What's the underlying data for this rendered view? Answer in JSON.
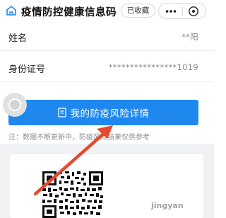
{
  "header": {
    "title": "疫情防控健康信息码",
    "favorite_label": "已收藏",
    "icons": [
      "home-icon",
      "more-icon",
      "close-icon"
    ]
  },
  "fields": [
    {
      "label": "姓名",
      "value": "**阳"
    },
    {
      "label": "身份证号",
      "value": "****************1019"
    }
  ],
  "cta": {
    "label": "我的防疫风险详情",
    "icon": "document-icon"
  },
  "note": "注：数据不断更新中，防疫风险结果仅供参考",
  "watermark": "jingyan",
  "colors": {
    "accent": "#1e88ee",
    "arrow": "#e8492f",
    "page_bg": "#f0f1f3"
  }
}
